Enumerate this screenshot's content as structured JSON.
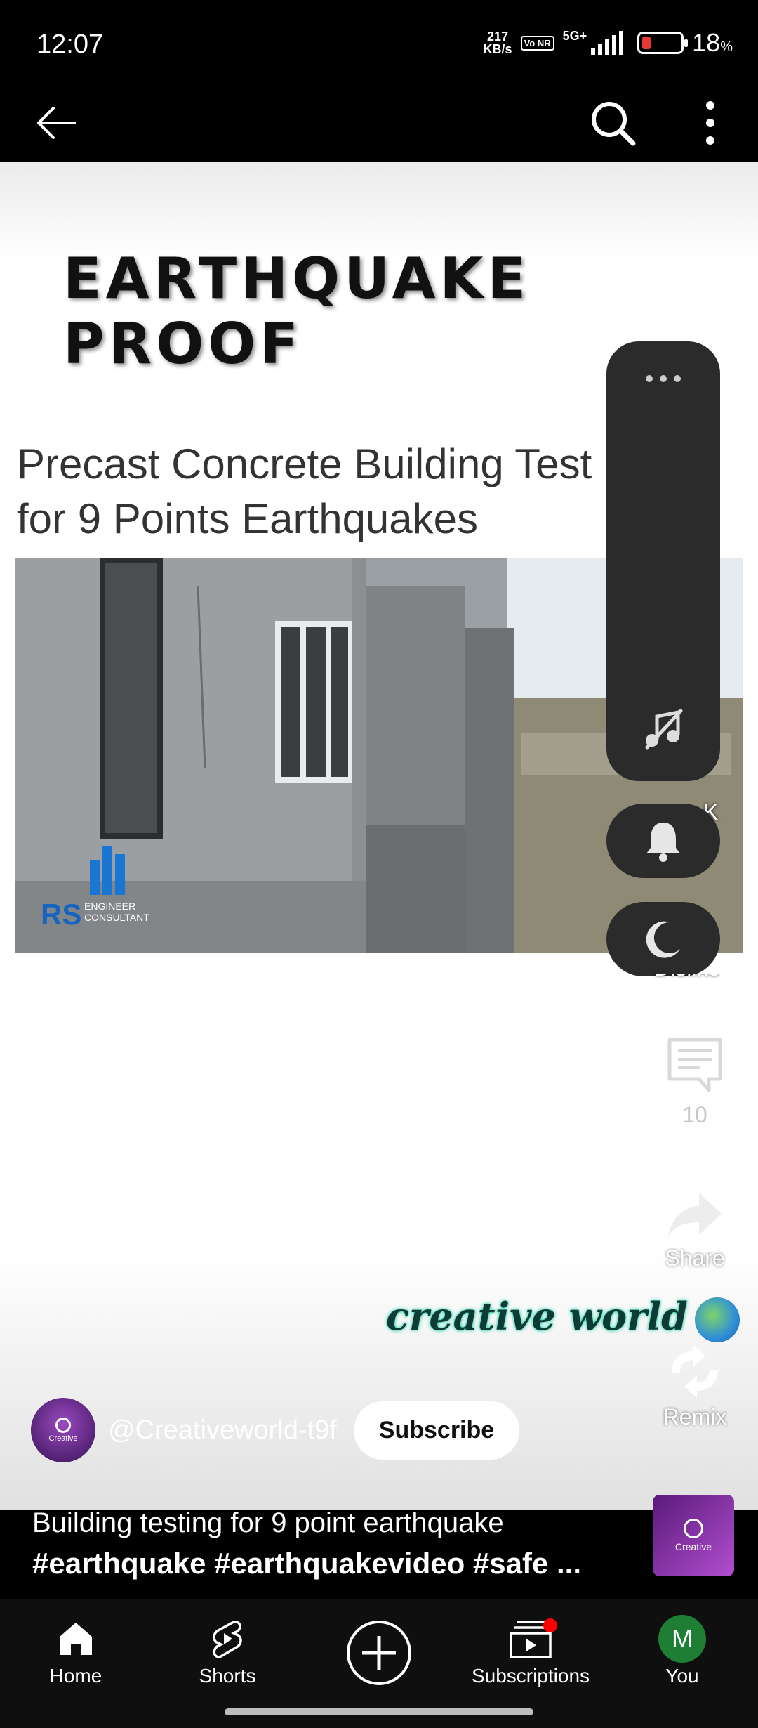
{
  "status_bar": {
    "time": "12:07",
    "net_speed_value": "217",
    "net_speed_unit": "KB/s",
    "volte": "Vo NR",
    "network": "5G+",
    "battery_value": "18",
    "battery_unit": "%"
  },
  "video": {
    "headline": "EARTHQUAKE PROOF",
    "subtitle_line1": "Precast Concrete Building Test",
    "subtitle_line2": "for 9 Points Earthquakes",
    "logo_text": "RS",
    "logo_subtext": "ENGINEER CONSULTANT",
    "watermark": "creative world"
  },
  "actions": {
    "like_partial": "K",
    "dislike_partial": "Dislike",
    "comments_count": "10",
    "share_label": "Share",
    "remix_label": "Remix"
  },
  "channel": {
    "handle": "@Creativeworld-t9f",
    "avatar_text": "Creative",
    "subscribe_label": "Subscribe"
  },
  "caption": {
    "title": "Building testing for 9 point earthquake",
    "hashtags": "#earthquake #earthquakevideo #safe ..."
  },
  "nav": {
    "home": "Home",
    "shorts": "Shorts",
    "subscriptions": "Subscriptions",
    "you": "You",
    "you_initial": "M"
  },
  "colors": {
    "subscriptions_dot": "#ff0000",
    "you_avatar": "#1e7e34",
    "battery_low": "#e53935"
  }
}
